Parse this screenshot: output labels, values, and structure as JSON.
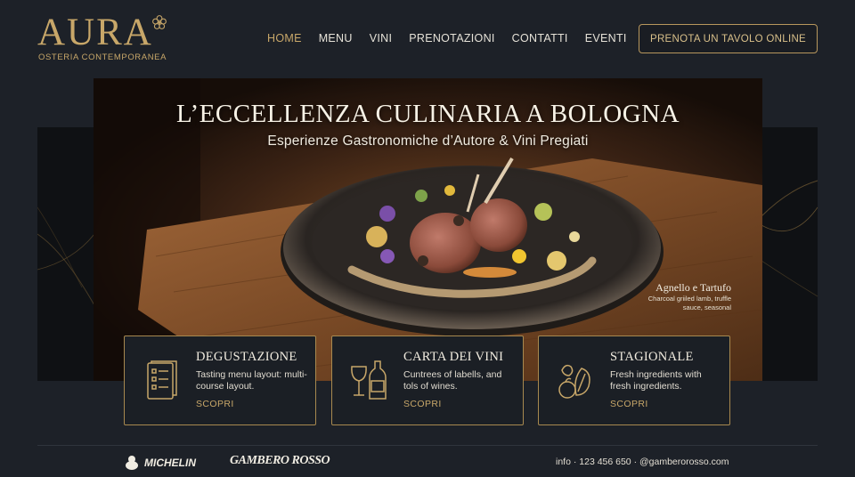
{
  "brand": {
    "name": "AURA",
    "tagline": "OSTERIA CONTEMPORANEA",
    "accent_color": "#c8a769"
  },
  "nav": {
    "items": [
      {
        "label": "HOME",
        "active": true
      },
      {
        "label": "MENU",
        "active": false
      },
      {
        "label": "VINI",
        "active": false
      },
      {
        "label": "PRENOTAZIONI",
        "active": false
      },
      {
        "label": "CONTATTI",
        "active": false
      },
      {
        "label": "EVENTI",
        "active": false
      }
    ],
    "cta_label": "PRENOTA UN TAVOLO ONLINE"
  },
  "hero": {
    "title": "L’ECCELLENZA CULINARIA A BOLOGNA",
    "subtitle": "Esperienze Gastronomiche d’Autore & Vini Pregiati",
    "dish": {
      "name": "Agnello e Tartufo",
      "description": "Charcoal griiled lamb, truffle sauce, seasonal"
    }
  },
  "cards": [
    {
      "title": "DEGUSTAZIONE",
      "description": "Tasting menu layout: multi-course layout.",
      "link": "SCOPRI",
      "icon": "menu-list-icon"
    },
    {
      "title": "CARTA DEI VINI",
      "description": "Cuntrees of labells, and tols of wines.",
      "link": "SCOPRI",
      "icon": "wine-glass-bottle-icon"
    },
    {
      "title": "STAGIONALE",
      "description": "Fresh ingredients with fresh ingredients.",
      "link": "SCOPRI",
      "icon": "vegetables-icon"
    }
  ],
  "footer": {
    "partners": [
      "MICHELIN",
      "GAMBERO ROSSO"
    ],
    "contact": "info · 123 456 650 · @gamberorosso.com"
  }
}
